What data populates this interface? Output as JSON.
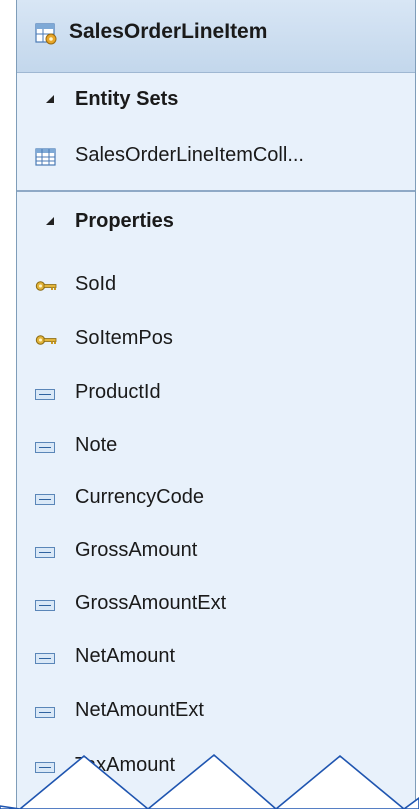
{
  "entity": {
    "name": "SalesOrderLineItem",
    "icon": "entity-type-icon"
  },
  "sections": {
    "entity_sets": {
      "label": "Entity Sets",
      "items": [
        {
          "label": "SalesOrderLineItemColl...",
          "icon": "entity-set-icon"
        }
      ]
    },
    "properties": {
      "label": "Properties",
      "items": [
        {
          "label": "SoId",
          "icon": "key-icon"
        },
        {
          "label": "SoItemPos",
          "icon": "key-icon"
        },
        {
          "label": "ProductId",
          "icon": "property-icon"
        },
        {
          "label": "Note",
          "icon": "property-icon"
        },
        {
          "label": "CurrencyCode",
          "icon": "property-icon"
        },
        {
          "label": "GrossAmount",
          "icon": "property-icon"
        },
        {
          "label": "GrossAmountExt",
          "icon": "property-icon"
        },
        {
          "label": "NetAmount",
          "icon": "property-icon"
        },
        {
          "label": "NetAmountExt",
          "icon": "property-icon"
        },
        {
          "label": "TaxAmount",
          "icon": "property-icon"
        }
      ]
    }
  },
  "colors": {
    "panel_bg": "#e8f1fb",
    "header_bg": "#c3d7ec",
    "border": "#7f9db9"
  }
}
